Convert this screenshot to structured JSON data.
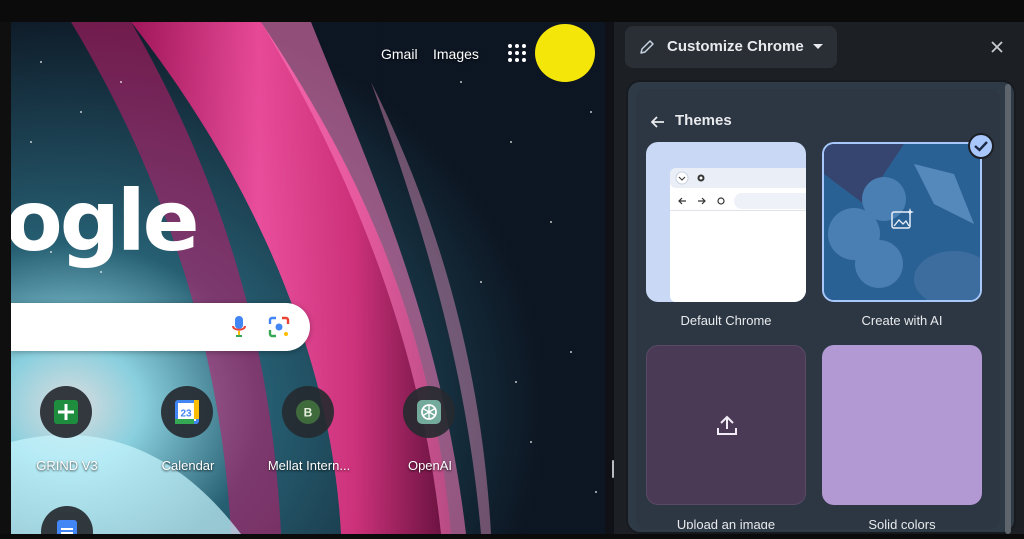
{
  "ntp": {
    "links": {
      "gmail": "Gmail",
      "images": "Images"
    },
    "logo_fragment": "ogle",
    "shortcuts": [
      {
        "label": "GRIND V3",
        "icon": "sheets-plus-icon"
      },
      {
        "label": "Calendar",
        "icon": "calendar-icon",
        "badge": "23"
      },
      {
        "label": "Mellat Intern...",
        "icon": "letter-b-icon",
        "badge": "B"
      },
      {
        "label": "OpenAI",
        "icon": "openai-icon"
      }
    ]
  },
  "panel": {
    "header_title": "Customize Chrome",
    "section_title": "Themes",
    "themes": [
      {
        "label": "Default Chrome",
        "selected": false
      },
      {
        "label": "Create with AI",
        "selected": true
      },
      {
        "label": "Upload an image",
        "selected": false
      },
      {
        "label": "Solid colors",
        "selected": false
      }
    ]
  },
  "colors": {
    "panel_bg": "#1c1f24",
    "card_bg": "#2d3743",
    "accent_check": "#a8c7fa",
    "upload_tile": "#4b3a55",
    "solid_tile": "#b399d4",
    "ai_tile": "#2b5a8a"
  }
}
